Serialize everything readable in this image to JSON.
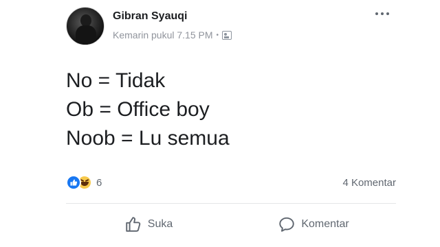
{
  "post": {
    "author": "Gibran Syauqi",
    "timestamp": "Kemarin pukul 7.15 PM",
    "separator": "•",
    "audience_icon": "friends-icon",
    "lines": [
      "No = Tidak",
      "Ob = Office boy",
      "Noob = Lu semua"
    ],
    "reactions": {
      "types": [
        "like",
        "haha"
      ],
      "count": "6"
    },
    "comment_count": "4 Komentar"
  },
  "actions": {
    "like_label": "Suka",
    "comment_label": "Komentar"
  },
  "colors": {
    "author": "#1c1e21",
    "meta": "#90949c",
    "like_blue": "#1877f2",
    "haha_yellow": "#f7c94b",
    "action_gray": "#606770"
  }
}
